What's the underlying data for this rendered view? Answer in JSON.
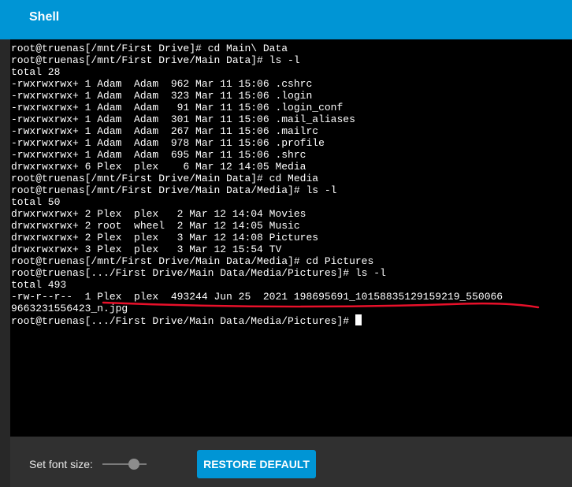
{
  "header": {
    "title": "Shell"
  },
  "terminal": {
    "lines": [
      "root@truenas[/mnt/First Drive]# cd Main\\ Data",
      "root@truenas[/mnt/First Drive/Main Data]# ls -l",
      "total 28",
      "-rwxrwxrwx+ 1 Adam  Adam  962 Mar 11 15:06 .cshrc",
      "-rwxrwxrwx+ 1 Adam  Adam  323 Mar 11 15:06 .login",
      "-rwxrwxrwx+ 1 Adam  Adam   91 Mar 11 15:06 .login_conf",
      "-rwxrwxrwx+ 1 Adam  Adam  301 Mar 11 15:06 .mail_aliases",
      "-rwxrwxrwx+ 1 Adam  Adam  267 Mar 11 15:06 .mailrc",
      "-rwxrwxrwx+ 1 Adam  Adam  978 Mar 11 15:06 .profile",
      "-rwxrwxrwx+ 1 Adam  Adam  695 Mar 11 15:06 .shrc",
      "drwxrwxrwx+ 6 Plex  plex    6 Mar 12 14:05 Media",
      "root@truenas[/mnt/First Drive/Main Data]# cd Media",
      "root@truenas[/mnt/First Drive/Main Data/Media]# ls -l",
      "total 50",
      "drwxrwxrwx+ 2 Plex  plex   2 Mar 12 14:04 Movies",
      "drwxrwxrwx+ 2 root  wheel  2 Mar 12 14:05 Music",
      "drwxrwxrwx+ 2 Plex  plex   3 Mar 12 14:08 Pictures",
      "drwxrwxrwx+ 3 Plex  plex   3 Mar 12 15:54 TV",
      "root@truenas[/mnt/First Drive/Main Data/Media]# cd Pictures",
      "root@truenas[.../First Drive/Main Data/Media/Pictures]# ls -l",
      "total 493",
      "-rw-r--r--  1 Plex  plex  493244 Jun 25  2021 198695691_10158835129159219_550066",
      "9663231556423_n.jpg"
    ],
    "prompt": "root@truenas[.../First Drive/Main Data/Media/Pictures]# "
  },
  "footer": {
    "font_size_label": "Set font size:",
    "font_size_level": 0.72,
    "restore_label": "RESTORE DEFAULT"
  },
  "colors": {
    "accent": "#0095d5",
    "annotation": "#e8102a",
    "terminal_bg": "#000000",
    "terminal_fg": "#ffffff"
  }
}
